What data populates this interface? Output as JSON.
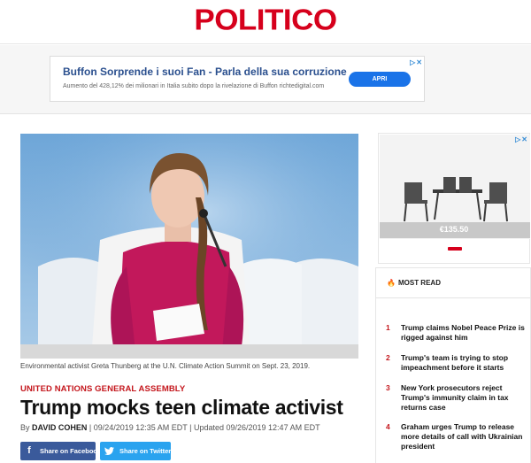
{
  "site": {
    "logo": "POLITICO",
    "brand_color": "#d6001c"
  },
  "top_ad": {
    "headline": "Buffon Sorprende i suoi Fan - Parla della sua corruzione",
    "subtext": "Aumento del 428,12% dei milionari in Italia subito dopo la rivelazione di Buffon richtedigital.com",
    "button_label": "APRI",
    "adchoices_icon": "adchoices-icon",
    "close_icon": "close-icon"
  },
  "article": {
    "image_caption": "Environmental activist Greta Thunberg at the U.N. Climate Action Summit on Sept. 23, 2019.",
    "kicker": "UNITED NATIONS GENERAL ASSEMBLY",
    "headline": "Trump mocks teen climate activist",
    "byline_prefix": "By",
    "author": "DAVID COHEN",
    "dates": "| 09/24/2019 12:35 AM EDT | Updated 09/26/2019 12:47 AM EDT",
    "share_facebook": "Share on Facebook",
    "share_twitter": "Share on Twitter",
    "facebook_color": "#3a5a9b",
    "twitter_color": "#2aa3ef"
  },
  "side_ad": {
    "price": "€135.50",
    "product_icon": "patio-furniture-image"
  },
  "most_read": {
    "heading": "MOST READ",
    "items": [
      {
        "num": "1",
        "title": "Trump claims Nobel Peace Prize is rigged against him"
      },
      {
        "num": "2",
        "title": "Trump's team is trying to stop impeachment before it starts"
      },
      {
        "num": "3",
        "title": "New York prosecutors reject Trump's immunity claim in tax returns case"
      },
      {
        "num": "4",
        "title": "Graham urges Trump to release more details of call with Ukrainian president"
      }
    ]
  }
}
